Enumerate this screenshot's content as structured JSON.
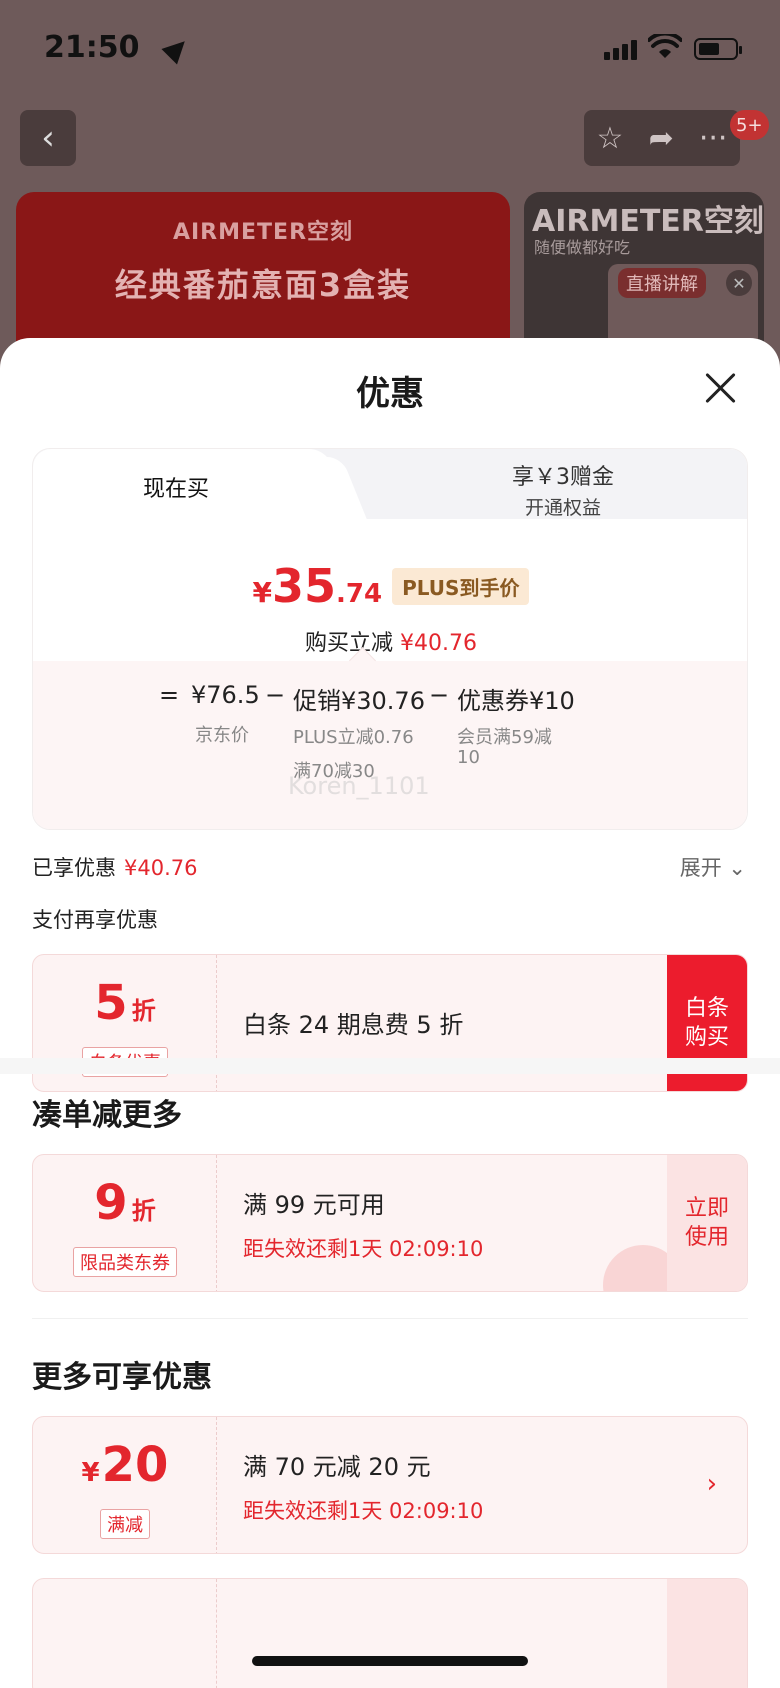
{
  "status_bar": {
    "time": "21:50"
  },
  "background": {
    "notification_count": "5+",
    "banner_brand": "AIRMETER空刻",
    "banner_title": "经典番茄意面3盒装",
    "side_brand": "AIRMETER空刻",
    "side_sub": "随便做都好吃",
    "live_tag": "直播讲解"
  },
  "sheet": {
    "title": "优惠",
    "tabs": {
      "now": "现在买",
      "plus_line1": "享￥3赠金",
      "plus_line2": "开通权益"
    },
    "price": {
      "symbol": "¥",
      "integer": "35",
      "decimal": ".74",
      "tag": "PLUS到手价"
    },
    "reduce": {
      "label": "购买立减",
      "amount": "¥40.76"
    },
    "breakdown": {
      "equals": "=",
      "jd_price": "¥76.5",
      "jd_label": "京东价",
      "minus1": "−",
      "promo": "促销¥30.76",
      "promo_sub1": "PLUS立减0.76",
      "promo_sub2": "满70减30",
      "minus2": "−",
      "coupon": "优惠券¥10",
      "coupon_sub1": "会员满59减",
      "coupon_sub2": "10"
    },
    "watermark": "Koren_1101",
    "enjoyed": {
      "label": "已享优惠",
      "amount": "¥40.76"
    },
    "expand": "展开",
    "pay_more": "支付再享优惠",
    "baitiao": {
      "value": "5",
      "unit": "折",
      "tag": "白条优惠",
      "desc": "白条 24 期息费 5 折",
      "action_line1": "白条",
      "action_line2": "购买"
    },
    "section_more": "凑单减更多",
    "coupon9": {
      "value": "9",
      "unit": "折",
      "tag": "限品类东券",
      "desc": "满 99 元可用",
      "expire": "距失效还剩1天 02:09:10",
      "action_line1": "立即",
      "action_line2": "使用"
    },
    "section_extra": "更多可享优惠",
    "coupon20": {
      "symbol": "¥",
      "value": "20",
      "tag": "满减",
      "desc": "满 70 元减 20 元",
      "expire": "距失效还剩1天 02:09:10"
    }
  }
}
